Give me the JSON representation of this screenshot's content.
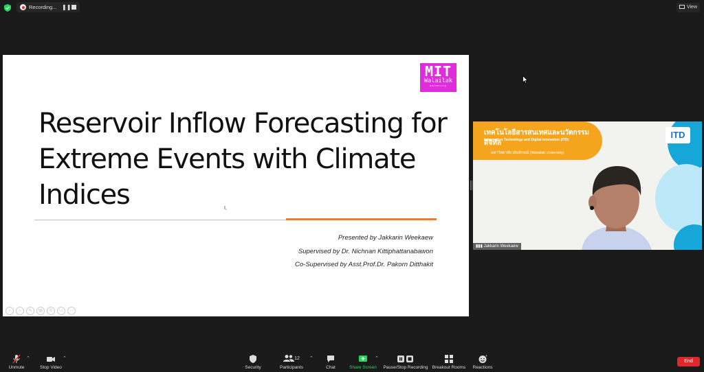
{
  "topbar": {
    "recording_label": "Recording...",
    "view_label": "View"
  },
  "slide": {
    "logo": {
      "line1": "MIT",
      "line2": "Walailak",
      "line3": "university"
    },
    "title_lines": [
      "Reservoir Inflow Forecasting for",
      "Extreme Events with Climate",
      "Indices"
    ],
    "cursor_glyph": "I,",
    "presented_by": "Presented by Jakkarin Weekaew",
    "supervised_by": "Supervised by Dr. Nichnan Kittiphattanabawon",
    "co_supervised_by": "Co-Supervised by Asst.Prof.Dr. Pakorn Ditthakit",
    "accent_color": "#ef7d31"
  },
  "video": {
    "banner_thai": "เทคโนโลยีสารสนเทศและนวัตกรรมดิจิทัล",
    "banner_english": "Information Technology and Digital Innovation (ITD)",
    "banner_university": "มหาวิทยาลัยวลัยลักษณ์ (Walailak University)",
    "logo_text": "ITD",
    "participant_name": "Jakkarin Weekaew"
  },
  "toolbar": {
    "unmute": "Unmute",
    "stop_video": "Stop Video",
    "security": "Security",
    "participants": "Participants",
    "participants_count": "12",
    "chat": "Chat",
    "share_screen": "Share Screen",
    "pause_stop_recording": "Pause/Stop Recording",
    "breakout_rooms": "Breakout Rooms",
    "reactions": "Reactions",
    "end": "End",
    "share_color": "#23d959",
    "end_color": "#e0272c"
  }
}
